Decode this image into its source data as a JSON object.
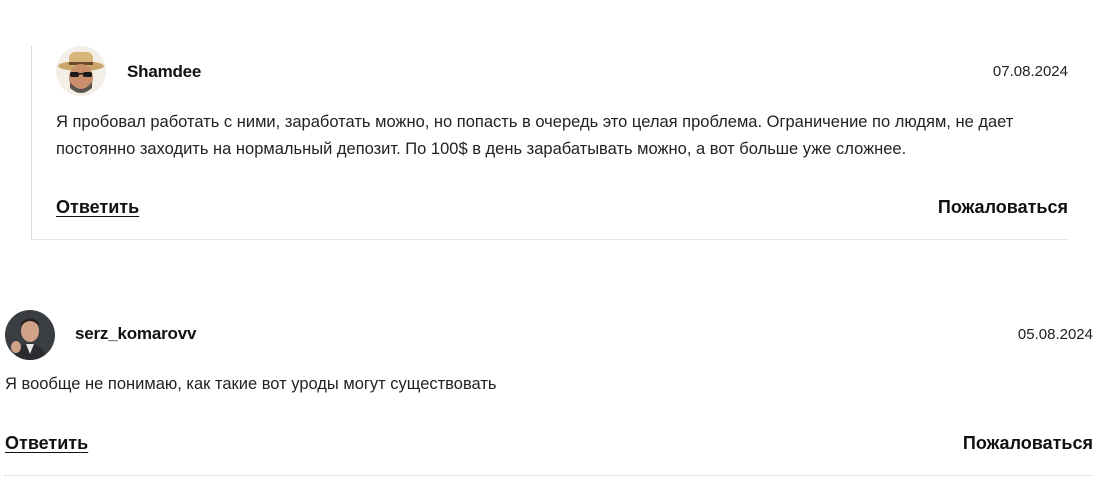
{
  "comments": [
    {
      "author": "Shamdee",
      "date": "07.08.2024",
      "text": "Я пробовал работать с ними, заработать можно, но попасть в очередь это целая проблема. Ограничение по людям, не дает постоянно заходить на нормальный депозит. По 100$ в день зарабатывать можно, а вот больше уже сложнее.",
      "reply_label": "Ответить",
      "report_label": "Пожаловаться"
    },
    {
      "author": "serz_komarovv",
      "date": "05.08.2024",
      "text": "Я вообще не понимаю, как такие вот уроды могут существовать",
      "reply_label": "Ответить",
      "report_label": "Пожаловаться"
    }
  ]
}
